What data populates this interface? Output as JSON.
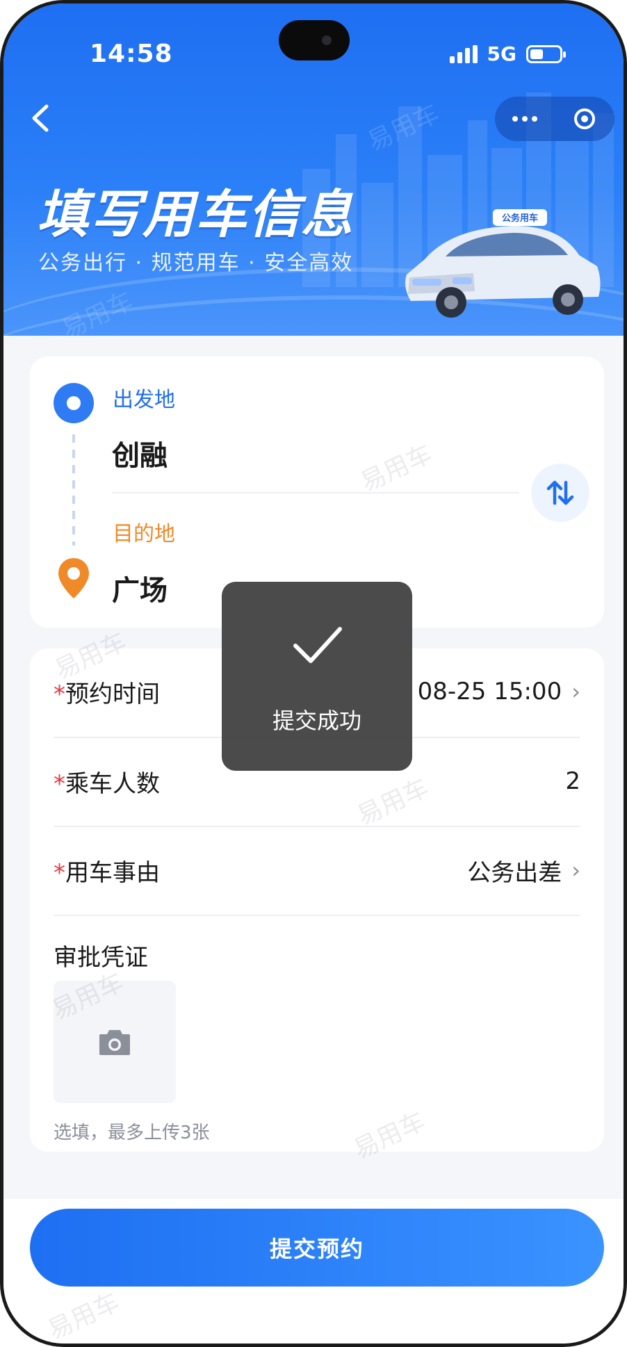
{
  "status_bar": {
    "time": "14:58",
    "network": "5G"
  },
  "nav": {
    "back_icon": "chevron-left-icon",
    "more_icon": "more-dots-icon",
    "target_icon": "target-circle-icon"
  },
  "hero": {
    "title": "填写用车信息",
    "subtitle": "公务出行 · 规范用车 · 安全高效",
    "car_roof_sign": "公务用车"
  },
  "route": {
    "departure_label": "出发地",
    "departure_value": "创融",
    "destination_label": "目的地",
    "destination_value": "广场",
    "swap_icon": "swap-vertical-icon"
  },
  "form": {
    "required_mark": "*",
    "reserve_time_label": "预约时间",
    "reserve_time_value": "08-25 15:00",
    "passengers_label": "乘车人数",
    "passengers_value": "2",
    "reason_label": "用车事由",
    "reason_value": "公务出差",
    "approval_label": "审批凭证",
    "upload_icon": "camera-icon",
    "upload_hint": "选填，最多上传3张"
  },
  "submit_button": "提交预约",
  "toast": {
    "icon": "checkmark-icon",
    "message": "提交成功"
  },
  "watermark": "易用车",
  "colors": {
    "primary": "#1e6ff2",
    "departure": "#2f7bf3",
    "destination": "#f08a28",
    "required": "#e8383d",
    "background": "#f4f6fa"
  }
}
